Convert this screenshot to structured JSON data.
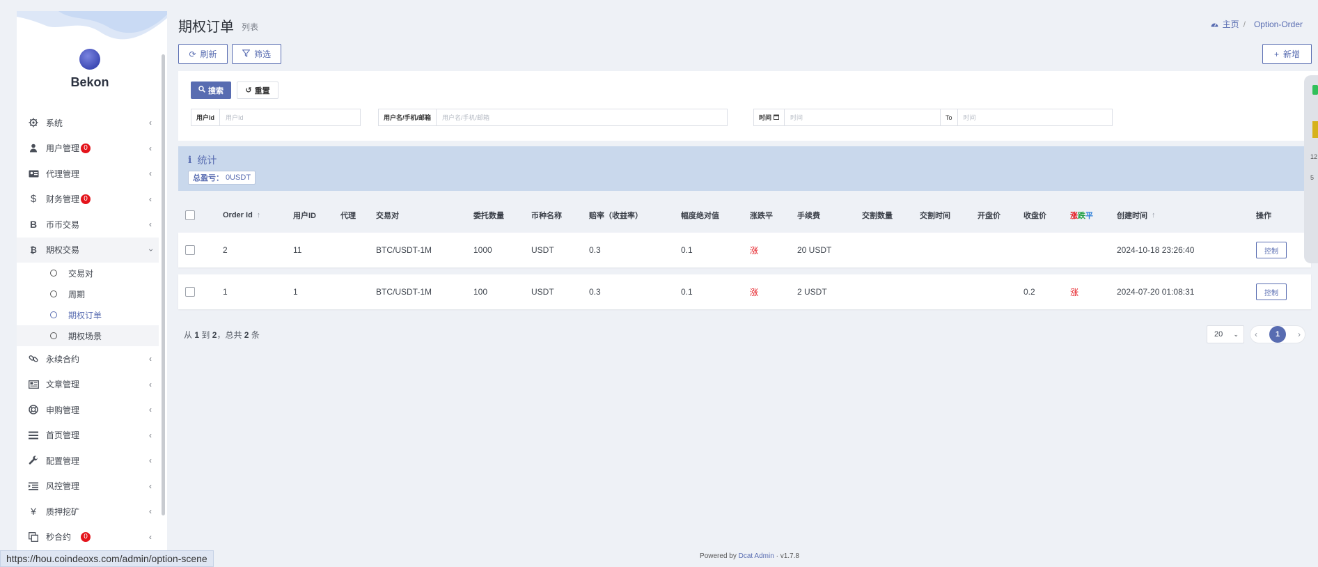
{
  "sidebar": {
    "brand": "Bekon",
    "menu": [
      {
        "label": "系统",
        "icon": "gear-icon"
      },
      {
        "label": "用户管理",
        "icon": "user-icon",
        "badge": "0"
      },
      {
        "label": "代理管理",
        "icon": "id-card-icon"
      },
      {
        "label": "财务管理",
        "icon": "dollar-icon",
        "badge": "0"
      },
      {
        "label": "币币交易",
        "icon": "bitcoin-icon"
      },
      {
        "label": "期权交易",
        "icon": "bitcoin-icon"
      },
      {
        "label": "永续合约",
        "icon": "link-icon"
      },
      {
        "label": "文章管理",
        "icon": "newspaper-icon"
      },
      {
        "label": "申购管理",
        "icon": "lifebuoy-icon"
      },
      {
        "label": "首页管理",
        "icon": "list-icon"
      },
      {
        "label": "配置管理",
        "icon": "wrench-icon"
      },
      {
        "label": "风控管理",
        "icon": "outdent-icon"
      },
      {
        "label": "质押挖矿",
        "icon": "yen-icon"
      },
      {
        "label": "秒合约",
        "icon": "copy-icon",
        "badge": "0"
      }
    ],
    "submenu": [
      "交易对",
      "周期",
      "期权订单",
      "期权场景"
    ]
  },
  "header": {
    "title": "期权订单",
    "subtitle": "列表",
    "breadcrumb_home": "主页",
    "breadcrumb_current": "Option-Order"
  },
  "toolbar": {
    "refresh": "刷新",
    "filter": "筛选",
    "create": "新增"
  },
  "filter": {
    "search": "搜索",
    "reset": "重置",
    "user_id_label": "用户Id",
    "user_id_placeholder": "用户Id",
    "account_label": "用户名/手机/邮箱",
    "account_placeholder": "用户名/手机/邮箱",
    "time_label": "时间",
    "time_from_placeholder": "时间",
    "to_label": "To",
    "time_to_placeholder": "时间"
  },
  "stats": {
    "title": "统计",
    "total_label": "总盈亏：",
    "total_value": "0USDT"
  },
  "table": {
    "columns": {
      "order_id": "Order Id",
      "user_id": "用户ID",
      "agent": "代理",
      "pair": "交易对",
      "amount": "委托数量",
      "currency": "币种名称",
      "odds": "赔率（收益率）",
      "range": "幅度绝对值",
      "direction": "涨跌平",
      "fee": "手续费",
      "delivery_amount": "交割数量",
      "delivery_time": "交割时间",
      "open_price": "开盘价",
      "close_price": "收盘价",
      "result_up": "涨",
      "result_down": "跌",
      "result_flat": "平",
      "created_at": "创建时间",
      "actions": "操作"
    },
    "rows": [
      {
        "order_id": "2",
        "user_id": "11",
        "agent": "",
        "pair": "BTC/USDT-1M",
        "amount": "1000",
        "currency": "USDT",
        "odds": "0.3",
        "range": "0.1",
        "direction": "涨",
        "fee": "20 USDT",
        "delivery_amount": "",
        "delivery_time": "",
        "open_price": "",
        "close_price": "",
        "result": "",
        "created_at": "2024-10-18 23:26:40",
        "action": "控制"
      },
      {
        "order_id": "1",
        "user_id": "1",
        "agent": "",
        "pair": "BTC/USDT-1M",
        "amount": "100",
        "currency": "USDT",
        "odds": "0.3",
        "range": "0.1",
        "direction": "涨",
        "fee": "2 USDT",
        "delivery_amount": "",
        "delivery_time": "",
        "open_price": "",
        "close_price": "0.2",
        "result": "涨",
        "created_at": "2024-07-20 01:08:31",
        "action": "控制"
      }
    ]
  },
  "pagination": {
    "summary_from_label": "从",
    "from": "1",
    "to_label": "到",
    "to": "2",
    "total_label": "，总共",
    "total": "2",
    "unit": "条",
    "page_size": "20",
    "current_page": "1"
  },
  "footer": {
    "powered_by": "Powered by",
    "link": "Dcat Admin",
    "sep": "·",
    "version": "v1.7.8"
  },
  "status_url": "https://hou.coindeoxs.com/admin/option-scene",
  "edge_widget": {
    "t1": "12",
    "t2": "5"
  },
  "colors": {
    "accent": "#586cb1",
    "up": "#e4141b",
    "stats_bg": "#c9d8ec"
  }
}
